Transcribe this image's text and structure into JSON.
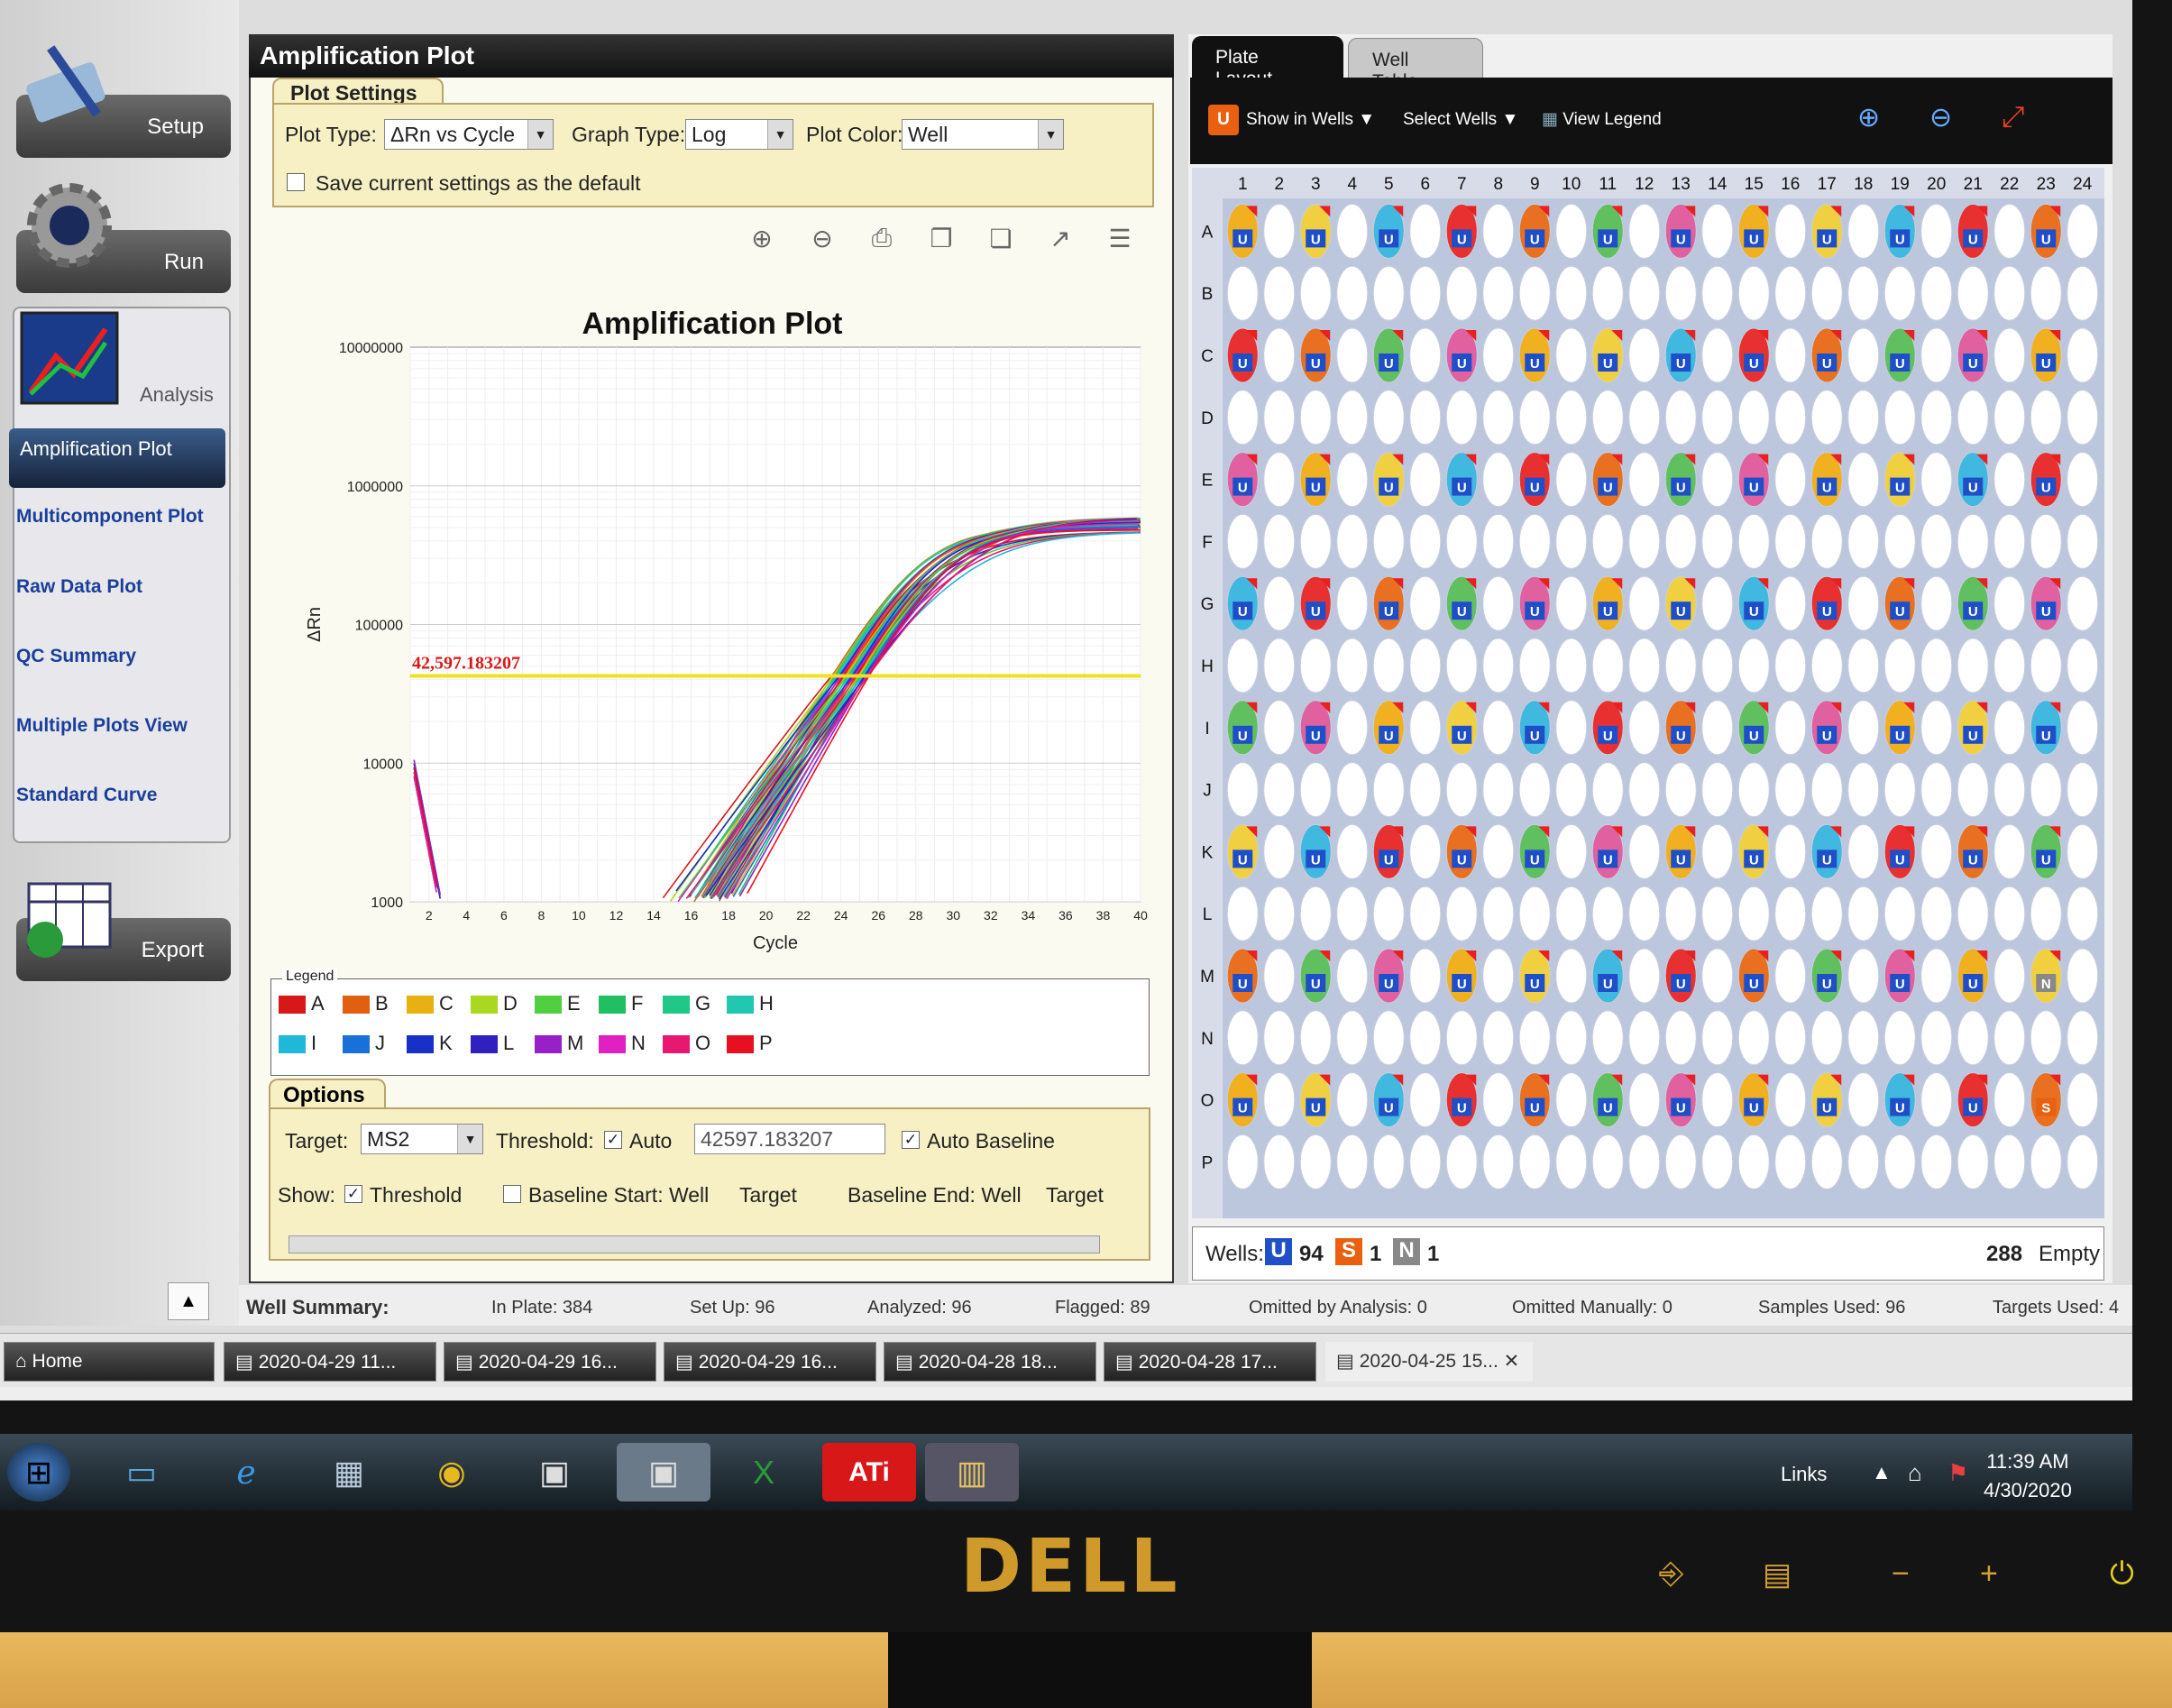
{
  "nav": {
    "setup": "Setup",
    "run": "Run",
    "analysis": "Analysis",
    "export": "Export",
    "sub": [
      "Amplification Plot",
      "Multicomponent Plot",
      "Raw Data Plot",
      "QC Summary",
      "Multiple Plots View",
      "Standard Curve"
    ]
  },
  "left": {
    "title": "Amplification Plot",
    "settings": {
      "tab": "Plot Settings",
      "plot_type_label": "Plot Type:",
      "plot_type": "ΔRn vs Cycle",
      "graph_type_label": "Graph Type:",
      "graph_type": "Log",
      "plot_color_label": "Plot Color:",
      "plot_color": "Well",
      "save_default": "Save current settings as the default"
    },
    "options": {
      "tab": "Options",
      "target_label": "Target:",
      "target": "MS2",
      "threshold_label": "Threshold:",
      "auto": "Auto",
      "threshold_value": "42597.183207",
      "auto_baseline": "Auto Baseline",
      "show_label": "Show:",
      "show_threshold": "Threshold",
      "baseline_start": "Baseline Start: Well",
      "target1": "Target",
      "baseline_end": "Baseline End: Well",
      "target2": "Target"
    },
    "legend_title": "Legend",
    "legend": [
      {
        "l": "A",
        "c": "#d81818"
      },
      {
        "l": "B",
        "c": "#e06010"
      },
      {
        "l": "C",
        "c": "#e8b010"
      },
      {
        "l": "D",
        "c": "#a8d820"
      },
      {
        "l": "E",
        "c": "#50d040"
      },
      {
        "l": "F",
        "c": "#20c060"
      },
      {
        "l": "G",
        "c": "#20c888"
      },
      {
        "l": "H",
        "c": "#20c8b0"
      },
      {
        "l": "I",
        "c": "#20b8d8"
      },
      {
        "l": "J",
        "c": "#1870d8"
      },
      {
        "l": "K",
        "c": "#1830c8"
      },
      {
        "l": "L",
        "c": "#3020c0"
      },
      {
        "l": "M",
        "c": "#9820c8"
      },
      {
        "l": "N",
        "c": "#e020c0"
      },
      {
        "l": "O",
        "c": "#e81870"
      },
      {
        "l": "P",
        "c": "#e81020"
      }
    ]
  },
  "chart_data": {
    "type": "line",
    "title": "Amplification Plot",
    "xlabel": "Cycle",
    "ylabel": "ΔRn",
    "yscale": "log",
    "xlim": [
      1,
      40
    ],
    "ylim": [
      1000,
      10000000
    ],
    "xticks": [
      "2",
      "4",
      "6",
      "8",
      "10",
      "12",
      "14",
      "16",
      "18",
      "20",
      "22",
      "24",
      "26",
      "28",
      "30",
      "32",
      "34",
      "36",
      "38",
      "40"
    ],
    "yticks": [
      "1000",
      "10000",
      "100000",
      "1000000",
      "10000000"
    ],
    "threshold": 42597.183207,
    "threshold_label": "42,597.183207",
    "series_shape": {
      "ct_range": [
        23.5,
        25.5
      ],
      "plateau": 550000
    },
    "grid": true
  },
  "right": {
    "tab_plate": "Plate Layout",
    "tab_well": "Well Table",
    "show_in_wells": "Show in Wells",
    "select_wells": "Select Wells",
    "view_legend": "View Legend",
    "cols": [
      "1",
      "2",
      "3",
      "4",
      "5",
      "6",
      "7",
      "8",
      "9",
      "10",
      "11",
      "12",
      "13",
      "14",
      "15",
      "16",
      "17",
      "18",
      "19",
      "20",
      "21",
      "22",
      "23",
      "24"
    ],
    "rows": [
      "A",
      "B",
      "C",
      "D",
      "E",
      "F",
      "G",
      "H",
      "I",
      "J",
      "K",
      "L",
      "M",
      "N",
      "O",
      "P"
    ],
    "wells_label": "Wells:",
    "u_count": "94",
    "s_count": "1",
    "n_count": "1",
    "empty": "288",
    "empty_label": "Empty"
  },
  "summary": {
    "title": "Well Summary:",
    "items": [
      "In Plate: 384",
      "Set Up: 96",
      "Analyzed: 96",
      "Flagged: 89",
      "Omitted by Analysis: 0",
      "Omitted Manually: 0",
      "Samples Used: 96",
      "Targets Used: 4"
    ]
  },
  "taskbar": {
    "home": "Home",
    "docs": [
      "2020-04-29 11...",
      "2020-04-29 16...",
      "2020-04-29 16...",
      "2020-04-28 18...",
      "2020-04-28 17...",
      "2020-04-25 15..."
    ]
  },
  "system": {
    "links": "Links",
    "time": "11:39 AM",
    "date": "4/30/2020"
  },
  "brand": "DELL"
}
